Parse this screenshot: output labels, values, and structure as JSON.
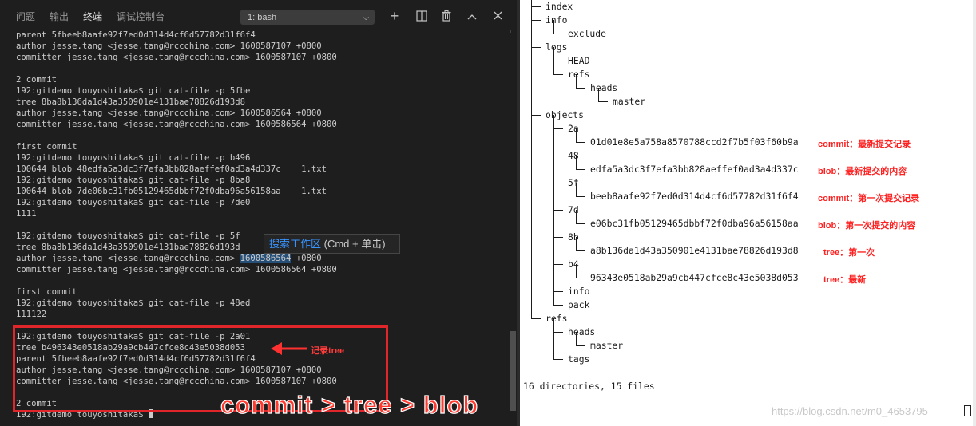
{
  "panel": {
    "tabs": [
      {
        "label": "问题"
      },
      {
        "label": "输出"
      },
      {
        "label": "终端"
      },
      {
        "label": "调试控制台"
      }
    ],
    "terminal_select": "1: bash",
    "icons": [
      "plus-icon",
      "split-icon",
      "trash-icon",
      "chevron-up-icon",
      "close-icon"
    ]
  },
  "terminal": {
    "lines": [
      "parent 5fbeeb8aafe92f7ed0d314d4cf6d57782d31f6f4",
      "author jesse.tang <jesse.tang@rccchina.com> 1600587107 +0800",
      "committer jesse.tang <jesse.tang@rccchina.com> 1600587107 +0800",
      "",
      "2 commit",
      "192:gitdemo touyoshitaka$ git cat-file -p 5fbe",
      "tree 8ba8b136da1d43a350901e4131bae78826d193d8",
      "author jesse.tang <jesse.tang@rccchina.com> 1600586564 +0800",
      "committer jesse.tang <jesse.tang@rccchina.com> 1600586564 +0800",
      "",
      "first commit",
      "192:gitdemo touyoshitaka$ git cat-file -p b496",
      "100644 blob 48edfa5a3dc3f7efa3bb828aeffef0ad3a4d337c    1.txt",
      "192:gitdemo touyoshitaka$ git cat-file -p 8ba8",
      "100644 blob 7de06bc31fb05129465dbbf72f0dba96a56158aa    1.txt",
      "192:gitdemo touyoshitaka$ git cat-file -p 7de0",
      "1111",
      "",
      "192:gitdemo touyoshitaka$ git cat-file -p 5f",
      "tree 8ba8b136da1d43a350901e4131bae78826d193d",
      "author jesse.tang <jesse.tang@rccchina.com> ",
      "committer jesse.tang <jesse.tang@rccchina.com> 1600586564 +0800",
      "",
      "first commit",
      "192:gitdemo touyoshitaka$ git cat-file -p 48ed",
      "111122",
      "",
      "192:gitdemo touyoshitaka$ git cat-file -p 2a01",
      "tree b496343e0518ab29a9cb447cfce8c43e5038d053",
      "parent 5fbeeb8aafe92f7ed0d314d4cf6d57782d31f6f4",
      "author jesse.tang <jesse.tang@rccchina.com> 1600587107 +0800",
      "committer jesse.tang <jesse.tang@rccchina.com> 1600587107 +0800",
      "",
      "2 commit",
      "192:gitdemo touyoshitaka$ "
    ],
    "highlight_word": "1600586564",
    "highlight_tail": " +0800",
    "tooltip_link": "搜索工作区",
    "tooltip_rest": " (Cmd + 单击)",
    "note_tree": "记录tree",
    "big_note": "commit > tree > blob"
  },
  "tree": {
    "lines": [
      "index",
      "info",
      "  exclude",
      "logs",
      "  HEAD",
      "  refs",
      "    heads",
      "      master",
      "objects",
      "  2a",
      "    01d01e8e5a758a8570788ccd2f7b5f03f60b9a",
      "  48",
      "    edfa5a3dc3f7efa3bb828aeffef0ad3a4d337c",
      "  5f",
      "    beeb8aafe92f7ed0d314d4cf6d57782d31f6f4",
      "  7d",
      "    e06bc31fb05129465dbbf72f0dba96a56158aa",
      "  8b",
      "    a8b136da1d43a350901e4131bae78826d193d8",
      "  b4",
      "    96343e0518ab29a9cb447cfce8c43e5038d053",
      "  info",
      "  pack",
      "refs",
      "  heads",
      "    master",
      "  tags",
      "",
      "16 directories, 15 files"
    ],
    "annotations": [
      {
        "text": "commit：最新提交记录",
        "row": 10
      },
      {
        "text": "blob：最新提交的内容",
        "row": 12
      },
      {
        "text": "commit：第一次提交记录",
        "row": 14
      },
      {
        "text": "blob：第一次提交的内容",
        "row": 16
      },
      {
        "text": "tree：第一次",
        "row": 18
      },
      {
        "text": "tree：最新",
        "row": 20
      }
    ],
    "watermark": "https://blog.csdn.net/m0_4653795"
  }
}
